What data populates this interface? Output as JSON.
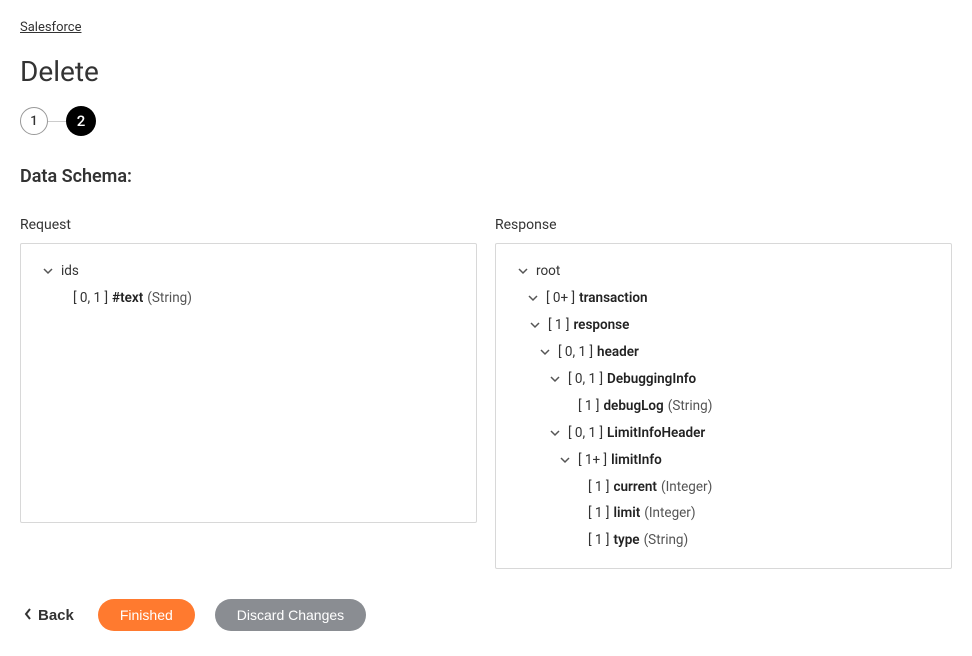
{
  "breadcrumb": {
    "label": "Salesforce"
  },
  "page_title": "Delete",
  "stepper": {
    "step1": "1",
    "step2": "2"
  },
  "section_title": "Data Schema:",
  "schema": {
    "request_label": "Request",
    "response_label": "Response",
    "request": {
      "root": {
        "name": "ids"
      },
      "text_card": "[ 0, 1 ]",
      "text_name": "#text",
      "text_type": "(String)"
    },
    "response": {
      "root": {
        "name": "root"
      },
      "transaction": {
        "card": "[ 0+ ]",
        "name": "transaction"
      },
      "resp": {
        "card": "[ 1 ]",
        "name": "response"
      },
      "header": {
        "card": "[ 0, 1 ]",
        "name": "header"
      },
      "debugging": {
        "card": "[ 0, 1 ]",
        "name": "DebuggingInfo"
      },
      "debuglog": {
        "card": "[ 1 ]",
        "name": "debugLog",
        "type": "(String)"
      },
      "limitheader": {
        "card": "[ 0, 1 ]",
        "name": "LimitInfoHeader"
      },
      "limitinfo": {
        "card": "[ 1+ ]",
        "name": "limitInfo"
      },
      "current": {
        "card": "[ 1 ]",
        "name": "current",
        "type": "(Integer)"
      },
      "limit": {
        "card": "[ 1 ]",
        "name": "limit",
        "type": "(Integer)"
      },
      "type": {
        "card": "[ 1 ]",
        "name": "type",
        "type": "(String)"
      }
    }
  },
  "actions": {
    "back": "Back",
    "finished": "Finished",
    "discard": "Discard Changes"
  }
}
